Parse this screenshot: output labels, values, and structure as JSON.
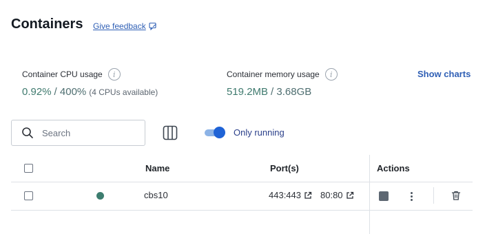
{
  "header": {
    "title": "Containers",
    "feedback_label": "Give feedback"
  },
  "stats": {
    "cpu": {
      "label": "Container CPU usage",
      "value": "0.92%",
      "total": "/ 400%",
      "note": "(4 CPUs available)"
    },
    "memory": {
      "label": "Container memory usage",
      "value": "519.2MB",
      "total": "/ 3.68GB"
    },
    "show_charts_label": "Show charts"
  },
  "toolbar": {
    "search_placeholder": "Search",
    "only_running_label": "Only running",
    "only_running_enabled": true
  },
  "table": {
    "columns": [
      "Name",
      "Port(s)",
      "Actions"
    ],
    "rows": [
      {
        "status": "running",
        "status_color": "#3d7d6f",
        "name": "cbs10",
        "ports": [
          "443:443",
          "80:80"
        ]
      }
    ]
  },
  "colors": {
    "accent_link": "#2f5fb5",
    "toggle_on": "#1f63d6",
    "stat_value": "#3f7a6e"
  },
  "icons": [
    "feedback-icon",
    "info-icon",
    "search-icon",
    "columns-icon",
    "external-link-icon",
    "stop-icon",
    "more-vertical-icon",
    "trash-icon"
  ]
}
